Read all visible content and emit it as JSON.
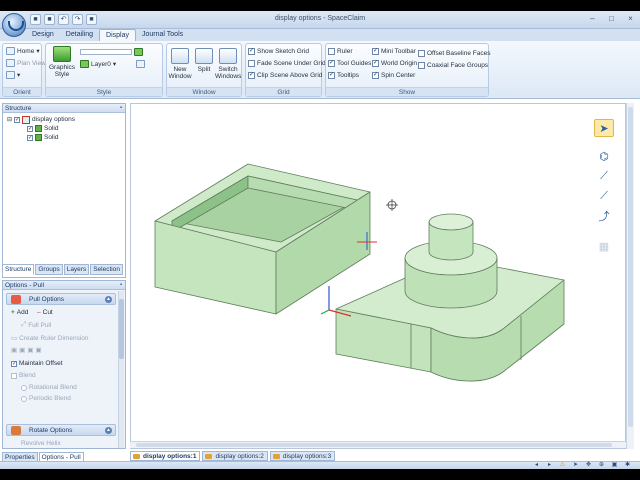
{
  "window": {
    "title": "display options - SpaceClaim",
    "minimize": "–",
    "maximize": "□",
    "close": "×"
  },
  "qat": [
    "■",
    "■",
    "↶",
    "↷",
    "■"
  ],
  "ribbon_tabs": [
    "Design",
    "Detailing",
    "Display",
    "Journal Tools"
  ],
  "ribbon": {
    "orient": {
      "label": "Orient",
      "home": "Home",
      "plan_view": "Plan View"
    },
    "style": {
      "label": "Style",
      "graphics_style": "Graphics Style",
      "layer": "Layer0"
    },
    "window": {
      "label": "Window",
      "new_window": "New Window",
      "split": "Split",
      "switch_windows": "Switch Windows"
    },
    "grid": {
      "label": "Grid",
      "items": [
        {
          "label": "Show Sketch Grid",
          "checked": true
        },
        {
          "label": "Fade Scene Under Grid",
          "checked": false
        },
        {
          "label": "Clip Scene Above Grid",
          "checked": true
        }
      ]
    },
    "show": {
      "label": "Show",
      "col1": [
        {
          "label": "Ruler",
          "checked": false
        },
        {
          "label": "Tool Guides",
          "checked": true
        },
        {
          "label": "Tooltips",
          "checked": true
        }
      ],
      "col2": [
        {
          "label": "Mini Toolbar",
          "checked": true
        },
        {
          "label": "World Origin",
          "checked": true
        },
        {
          "label": "Spin Center",
          "checked": true
        }
      ],
      "col3": [
        {
          "label": "Offset Baseline Faces",
          "checked": false
        },
        {
          "label": "Coaxial Face Groups",
          "checked": false
        }
      ]
    }
  },
  "structure": {
    "title": "Structure",
    "root": "display options",
    "children": [
      "Solid",
      "Solid"
    ],
    "tabs": [
      "Structure",
      "Groups",
      "Layers",
      "Selection"
    ]
  },
  "options": {
    "title": "Options - Pull",
    "pull_section": "Pull Options",
    "add": "Add",
    "cut": "Cut",
    "full_pull": "Full Pull",
    "ruler_dimension": "Create Ruler Dimension",
    "maintain_offset": "Maintain Offset",
    "blend": "Blend",
    "rotational_blend": "Rotational Blend",
    "periodic_blend": "Periodic Blend",
    "rotate_section": "Rotate Options",
    "revolve_helix": "Revolve Helix"
  },
  "bottom_tabs": [
    "Properties",
    "Options - Pull"
  ],
  "doc_tabs": [
    "display options:1",
    "display options:2",
    "display options:3"
  ],
  "colors": {
    "model_fill": "#c9e8c5",
    "model_stroke": "#5f7d5d",
    "accent": "#2d5fa0"
  }
}
